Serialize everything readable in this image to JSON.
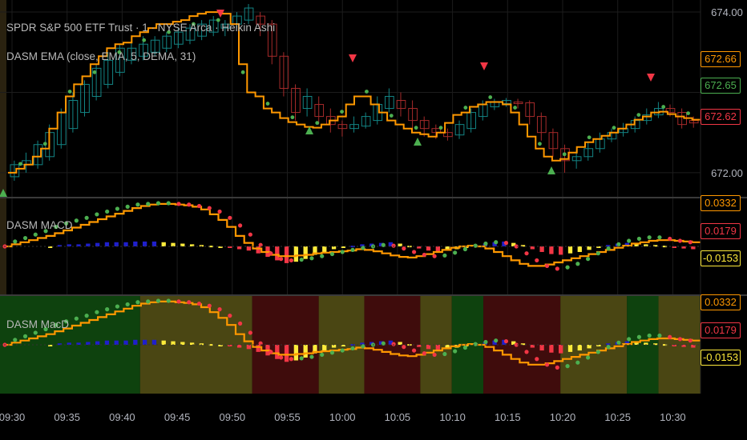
{
  "header": {
    "symbol_line": "SPDR S&P 500 ETF Trust · 1 · NYSE Arca · Heikin Ashi",
    "study_line": "DASM EMA (close, EMA, 5, DEMA, 31)"
  },
  "colors": {
    "orange": "#ff9800",
    "green_dot": "#4caf50",
    "red_dot": "#f23645",
    "up_candle": "#138484",
    "down_candle": "#a52a2a",
    "blue_bar": "#1f1fcc",
    "yellow_bar": "#ffeb3b",
    "bg_green": "#0e420e",
    "bg_yellow": "#4a4613",
    "bg_red": "#3f0c0c"
  },
  "chart_data": [
    {
      "type": "candlestick",
      "title": "SPDR S&P 500 ETF Trust · 1 · NYSE Arca · Heikin Ashi",
      "study": "DASM EMA (close, EMA, 5, DEMA, 31)",
      "y_ticks": [
        "674.00",
        "672.00"
      ],
      "ylim": [
        671.7,
        674.15
      ],
      "x_ticks": [
        "09:30",
        "09:35",
        "09:40",
        "09:45",
        "09:50",
        "09:55",
        "10:00",
        "10:05",
        "10:10",
        "10:15",
        "10:20",
        "10:25",
        "10:30"
      ],
      "price_tags": [
        {
          "label": "672.66",
          "value": 672.66,
          "color": "#ff9800"
        },
        {
          "label": "672.65",
          "value": 672.65,
          "color": "#4caf50"
        },
        {
          "label": "672.62",
          "value": 672.62,
          "color": "#f23645"
        }
      ],
      "ema_line": [
        672.0,
        672.05,
        672.1,
        672.2,
        672.3,
        672.55,
        672.75,
        672.95,
        673.1,
        673.2,
        673.35,
        673.45,
        673.55,
        673.6,
        673.62,
        673.7,
        673.75,
        673.8,
        673.85,
        673.85,
        673.88,
        673.9,
        673.95,
        673.98,
        674.0,
        674.0,
        673.98,
        673.85,
        673.35,
        673.0,
        672.95,
        672.8,
        672.75,
        672.68,
        672.63,
        672.6,
        672.57,
        672.56,
        672.6,
        672.65,
        672.7,
        672.85,
        672.95,
        672.95,
        672.85,
        672.75,
        672.65,
        672.6,
        672.55,
        672.5,
        672.48,
        672.45,
        672.5,
        672.62,
        672.72,
        672.75,
        672.82,
        672.85,
        672.88,
        672.88,
        672.85,
        672.75,
        672.6,
        672.45,
        672.3,
        672.2,
        672.15,
        672.17,
        672.25,
        672.32,
        672.38,
        672.42,
        672.46,
        672.5,
        672.55,
        672.6,
        672.66,
        672.7,
        672.75,
        672.76,
        672.73,
        672.7,
        672.68,
        672.66
      ],
      "candles": [
        [
          671.95,
          672.1,
          671.9,
          672.15
        ],
        [
          672.1,
          672.15,
          672.0,
          672.25
        ],
        [
          672.1,
          672.35,
          672.05,
          672.4
        ],
        [
          672.2,
          672.5,
          672.15,
          672.6
        ],
        [
          672.35,
          672.75,
          672.3,
          672.8
        ],
        [
          672.55,
          672.9,
          672.5,
          673.0
        ],
        [
          672.75,
          673.1,
          672.7,
          673.15
        ],
        [
          672.95,
          673.3,
          672.9,
          673.35
        ],
        [
          673.1,
          673.4,
          673.05,
          673.5
        ],
        [
          673.25,
          673.55,
          673.2,
          673.6
        ],
        [
          673.4,
          673.55,
          673.35,
          673.65
        ],
        [
          673.45,
          673.6,
          673.4,
          673.7
        ],
        [
          673.5,
          673.65,
          673.45,
          673.7
        ],
        [
          673.55,
          673.7,
          673.5,
          673.75
        ],
        [
          673.6,
          673.75,
          673.55,
          673.8
        ],
        [
          673.65,
          673.8,
          673.6,
          673.85
        ],
        [
          673.7,
          673.85,
          673.65,
          673.9
        ],
        [
          673.75,
          673.9,
          673.7,
          673.95
        ],
        [
          673.8,
          673.85,
          673.7,
          673.9
        ],
        [
          673.85,
          673.95,
          673.8,
          674.0
        ],
        [
          673.9,
          674.05,
          673.85,
          674.1
        ],
        [
          673.95,
          673.85,
          673.7,
          674.0
        ],
        [
          673.85,
          673.45,
          673.35,
          673.9
        ],
        [
          673.45,
          673.05,
          672.95,
          673.5
        ],
        [
          673.05,
          672.75,
          672.65,
          673.1
        ],
        [
          672.8,
          672.95,
          672.7,
          673.05
        ],
        [
          672.85,
          672.7,
          672.6,
          672.95
        ],
        [
          672.7,
          672.6,
          672.5,
          672.8
        ],
        [
          672.6,
          672.55,
          672.45,
          672.65
        ],
        [
          672.55,
          672.6,
          672.5,
          672.7
        ],
        [
          672.58,
          672.7,
          672.55,
          672.75
        ],
        [
          672.65,
          672.85,
          672.6,
          672.95
        ],
        [
          672.8,
          672.95,
          672.75,
          673.05
        ],
        [
          672.9,
          672.8,
          672.7,
          673.0
        ],
        [
          672.8,
          672.65,
          672.55,
          672.9
        ],
        [
          672.65,
          672.55,
          672.45,
          672.7
        ],
        [
          672.55,
          672.5,
          672.42,
          672.6
        ],
        [
          672.5,
          672.45,
          672.4,
          672.55
        ],
        [
          672.47,
          672.6,
          672.42,
          672.65
        ],
        [
          672.55,
          672.75,
          672.5,
          672.8
        ],
        [
          672.7,
          672.85,
          672.65,
          672.9
        ],
        [
          672.82,
          672.88,
          672.78,
          672.92
        ],
        [
          672.86,
          672.9,
          672.82,
          672.93
        ],
        [
          672.88,
          672.86,
          672.8,
          672.92
        ],
        [
          672.87,
          672.7,
          672.6,
          672.9
        ],
        [
          672.7,
          672.5,
          672.4,
          672.75
        ],
        [
          672.5,
          672.3,
          672.2,
          672.55
        ],
        [
          672.3,
          672.15,
          672.0,
          672.35
        ],
        [
          672.15,
          672.2,
          672.05,
          672.28
        ],
        [
          672.2,
          672.3,
          672.15,
          672.38
        ],
        [
          672.3,
          672.42,
          672.25,
          672.5
        ],
        [
          672.42,
          672.5,
          672.38,
          672.55
        ],
        [
          672.5,
          672.55,
          672.45,
          672.62
        ],
        [
          672.55,
          672.65,
          672.5,
          672.7
        ],
        [
          672.65,
          672.72,
          672.6,
          672.8
        ],
        [
          672.72,
          672.8,
          672.68,
          672.88
        ],
        [
          672.8,
          672.75,
          672.7,
          672.85
        ],
        [
          672.75,
          672.6,
          672.55,
          672.8
        ],
        [
          672.65,
          672.62,
          672.56,
          672.7
        ]
      ]
    },
    {
      "type": "macd",
      "title": "DASM MACD",
      "value_tags": [
        {
          "label": "0.0332",
          "value": 0.0332,
          "color": "#ff9800"
        },
        {
          "label": "0.0179",
          "value": 0.0179,
          "color": "#f23645"
        },
        {
          "label": "-0.0153",
          "value": -0.0153,
          "color": "#ffeb3b"
        }
      ],
      "ylim": [
        -0.062,
        0.062
      ],
      "signal_line": [
        0.0,
        0.003,
        0.006,
        0.009,
        0.012,
        0.015,
        0.019,
        0.023,
        0.027,
        0.031,
        0.035,
        0.039,
        0.043,
        0.047,
        0.051,
        0.055,
        0.058,
        0.06,
        0.061,
        0.061,
        0.06,
        0.059,
        0.057,
        0.053,
        0.046,
        0.038,
        0.028,
        0.015,
        0.005,
        -0.003,
        -0.008,
        -0.012,
        -0.014,
        -0.014,
        -0.013,
        -0.012,
        -0.01,
        -0.009,
        -0.008,
        -0.007,
        -0.006,
        -0.004,
        -0.005,
        -0.007,
        -0.01,
        -0.013,
        -0.015,
        -0.016,
        -0.014,
        -0.011,
        -0.008,
        -0.005,
        -0.002,
        0.0,
        0.001,
        0.0,
        -0.003,
        -0.008,
        -0.014,
        -0.02,
        -0.025,
        -0.028,
        -0.028,
        -0.026,
        -0.023,
        -0.02,
        -0.017,
        -0.014,
        -0.011,
        -0.008,
        -0.005,
        -0.002,
        0.001,
        0.004,
        0.006,
        0.008,
        0.009,
        0.009,
        0.008,
        0.007,
        0.006
      ],
      "macd_dots": [
        0.0,
        0.007,
        0.012,
        0.017,
        0.022,
        0.028,
        0.033,
        0.037,
        0.041,
        0.046,
        0.05,
        0.054,
        0.057,
        0.06,
        0.061,
        0.062,
        0.062,
        0.061,
        0.06,
        0.058,
        0.055,
        0.05,
        0.041,
        0.03,
        0.017,
        0.002,
        -0.01,
        -0.018,
        -0.02,
        -0.019,
        -0.017,
        -0.014,
        -0.011,
        -0.008,
        -0.005,
        -0.002,
        0.0,
        0.002,
        0.001,
        -0.003,
        -0.008,
        -0.012,
        -0.014,
        -0.013,
        -0.009,
        -0.004,
        0.001,
        0.004,
        0.006,
        0.005,
        0.0,
        -0.01,
        -0.02,
        -0.028,
        -0.032,
        -0.03,
        -0.025,
        -0.018,
        -0.01,
        -0.003,
        0.003,
        0.008,
        0.011,
        0.013,
        0.013,
        0.011,
        0.008,
        0.006
      ],
      "histogram": [
        0.0,
        0.002,
        0.003,
        0.003,
        0.004,
        0.005,
        0.006,
        0.006,
        0.006,
        0.007,
        0.007,
        0.007,
        0.006,
        0.005,
        0.004,
        0.003,
        0.002,
        0.001,
        0.0,
        -0.002,
        -0.004,
        -0.006,
        -0.01,
        -0.015,
        -0.02,
        -0.024,
        -0.022,
        -0.018,
        -0.012,
        -0.008,
        -0.004,
        -0.002,
        0.001,
        0.003,
        0.004,
        0.005,
        0.006,
        0.004,
        0.001,
        -0.003,
        -0.006,
        -0.007,
        -0.006,
        -0.004,
        -0.002,
        0.002,
        0.004,
        0.006,
        0.007,
        0.005,
        0.002,
        -0.004,
        -0.008,
        -0.011,
        -0.012,
        -0.01,
        -0.008,
        -0.005,
        -0.002,
        0.002,
        0.004,
        0.005,
        0.004,
        0.003,
        0.002,
        0.001,
        -0.002,
        -0.003,
        -0.004
      ]
    },
    {
      "type": "macd",
      "title": "DASM MacD",
      "value_tags": [
        {
          "label": "0.0332",
          "value": 0.0332,
          "color": "#ff9800"
        },
        {
          "label": "0.0179",
          "value": 0.0179,
          "color": "#f23645"
        },
        {
          "label": "-0.0153",
          "value": -0.0153,
          "color": "#ffeb3b"
        }
      ],
      "background_zones": [
        {
          "from": 0.0,
          "to": 0.2,
          "color": "#0e420e"
        },
        {
          "from": 0.2,
          "to": 0.36,
          "color": "#4a4613"
        },
        {
          "from": 0.36,
          "to": 0.455,
          "color": "#3f0c0c"
        },
        {
          "from": 0.455,
          "to": 0.52,
          "color": "#4a4613"
        },
        {
          "from": 0.52,
          "to": 0.6,
          "color": "#3f0c0c"
        },
        {
          "from": 0.6,
          "to": 0.645,
          "color": "#4a4613"
        },
        {
          "from": 0.645,
          "to": 0.69,
          "color": "#0e420e"
        },
        {
          "from": 0.69,
          "to": 0.8,
          "color": "#3f0c0c"
        },
        {
          "from": 0.8,
          "to": 0.895,
          "color": "#4a4613"
        },
        {
          "from": 0.895,
          "to": 0.94,
          "color": "#0e420e"
        },
        {
          "from": 0.94,
          "to": 1.0,
          "color": "#4a4613"
        }
      ]
    }
  ]
}
